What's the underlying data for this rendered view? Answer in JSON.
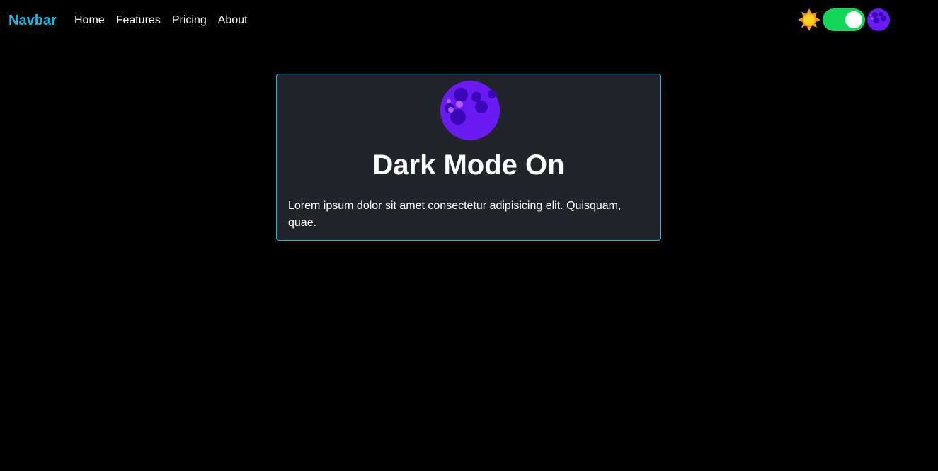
{
  "navbar": {
    "brand": "Navbar",
    "links": [
      {
        "label": "Home"
      },
      {
        "label": "Features"
      },
      {
        "label": "Pricing"
      },
      {
        "label": "About"
      }
    ]
  },
  "theme_switch": {
    "left_icon": "sun-icon",
    "right_icon": "moon-icon",
    "state": "dark",
    "toggle_color": "#12d65a"
  },
  "card": {
    "icon": "moon-icon",
    "title": "Dark Mode On",
    "text": "Lorem ipsum dolor sit amet consectetur adipisicing elit. Quisquam, quae."
  },
  "colors": {
    "accent": "#17b8e6",
    "background": "#000000",
    "card_background": "#212529",
    "moon": "#6a1bf2"
  }
}
